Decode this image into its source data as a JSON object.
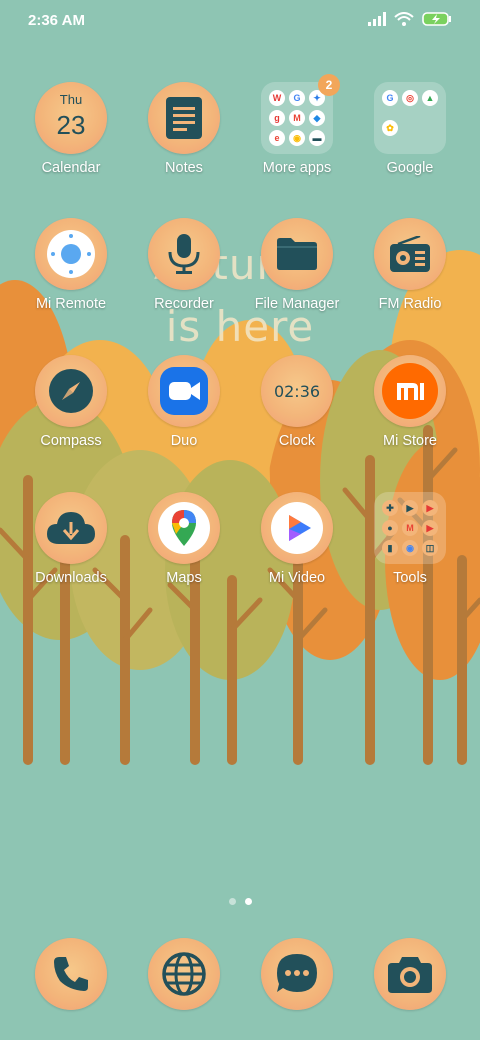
{
  "status_bar": {
    "time": "2:36 AM"
  },
  "wallpaper": {
    "line1": "Autumn",
    "line2": "is here"
  },
  "apps": {
    "calendar": {
      "label": "Calendar",
      "day": "Thu",
      "date": "23"
    },
    "notes": {
      "label": "Notes"
    },
    "more_apps": {
      "label": "More apps",
      "badge": "2"
    },
    "google": {
      "label": "Google"
    },
    "mi_remote": {
      "label": "Mi Remote"
    },
    "recorder": {
      "label": "Recorder"
    },
    "file_manager": {
      "label": "File Manager"
    },
    "fm_radio": {
      "label": "FM Radio"
    },
    "compass": {
      "label": "Compass"
    },
    "duo": {
      "label": "Duo"
    },
    "clock": {
      "label": "Clock",
      "time": "02:36"
    },
    "mi_store": {
      "label": "Mi Store"
    },
    "downloads": {
      "label": "Downloads"
    },
    "maps": {
      "label": "Maps"
    },
    "mi_video": {
      "label": "Mi Video"
    },
    "tools": {
      "label": "Tools"
    }
  },
  "dock": [
    "phone",
    "browser",
    "messages",
    "camera"
  ],
  "page_indicator": {
    "pages": 2,
    "current": 2
  },
  "colors": {
    "background": "#8ec5b3",
    "icon_glyph": "#22505a",
    "icon_bg": "#f3b57a"
  }
}
